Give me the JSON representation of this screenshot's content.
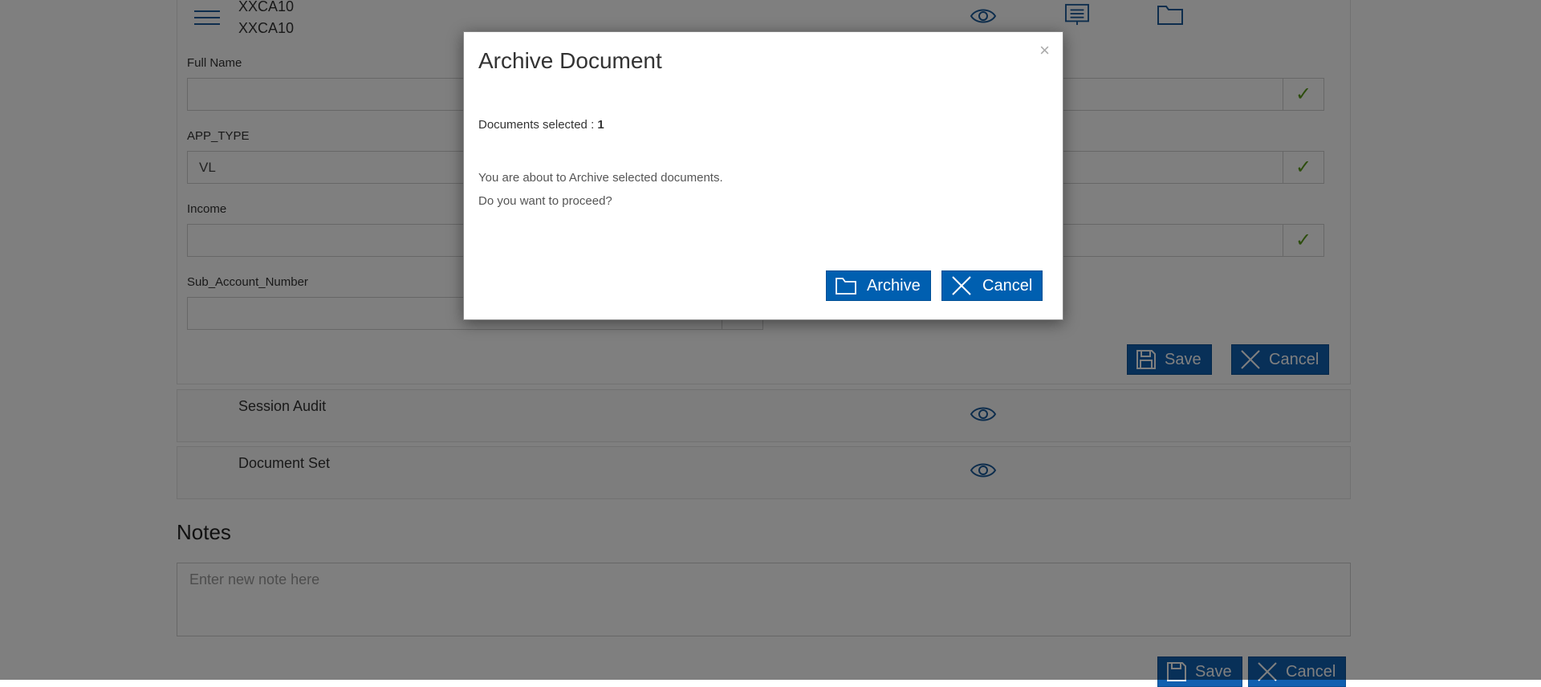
{
  "header": {
    "doc_code_1": "XXCA10",
    "doc_code_2": "XXCA10"
  },
  "fields": {
    "full_name": {
      "label": "Full Name",
      "value": ""
    },
    "app_type": {
      "label": "APP_TYPE",
      "value": "VL"
    },
    "income": {
      "label": "Income",
      "value": ""
    },
    "sub_account_number": {
      "label": "Sub_Account_Number",
      "value": ""
    }
  },
  "form_actions": {
    "save_label": "Save",
    "cancel_label": "Cancel"
  },
  "sections": {
    "session_audit": "Session Audit",
    "document_set": "Document Set"
  },
  "notes": {
    "title": "Notes",
    "placeholder": "Enter new note here"
  },
  "bottom_actions": {
    "save_label": "Save",
    "cancel_label": "Cancel"
  },
  "modal": {
    "title": "Archive Document",
    "close_glyph": "×",
    "selected_label": "Documents selected : ",
    "selected_count": "1",
    "message_line1": "You are about to Archive selected documents.",
    "message_line2": "Do you want to proceed?",
    "archive_label": "Archive",
    "cancel_label": "Cancel"
  },
  "icons": {
    "menu": "hamburger-icon",
    "view": "eye-icon",
    "display": "monitor-icon",
    "folder": "folder-icon",
    "check": "checkmark-icon",
    "save": "floppy-icon",
    "cancel": "close-icon"
  },
  "colors": {
    "accent": "#1160b0",
    "check": "#5a9a1a",
    "overlay": "rgba(0,0,0,0.5)"
  }
}
